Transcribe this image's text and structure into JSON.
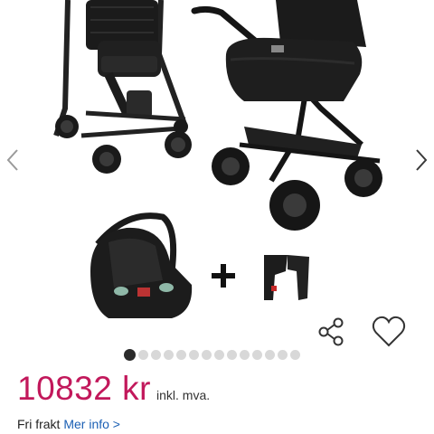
{
  "gallery": {
    "image_alt": "Barnevogn med bilstol og adaptere",
    "total_images": 14,
    "active_index": 0,
    "prev_icon": "chevron-left-icon",
    "next_icon": "chevron-right-icon"
  },
  "actions": {
    "share_icon": "share-icon",
    "favorite_icon": "heart-icon"
  },
  "price": {
    "amount": "10832 kr",
    "vat_note": "inkl. mva.",
    "color": "#c2185b"
  },
  "shipping": {
    "text": "Fri frakt",
    "link_label": "Mer info >",
    "link_color": "#1a5fb4"
  }
}
